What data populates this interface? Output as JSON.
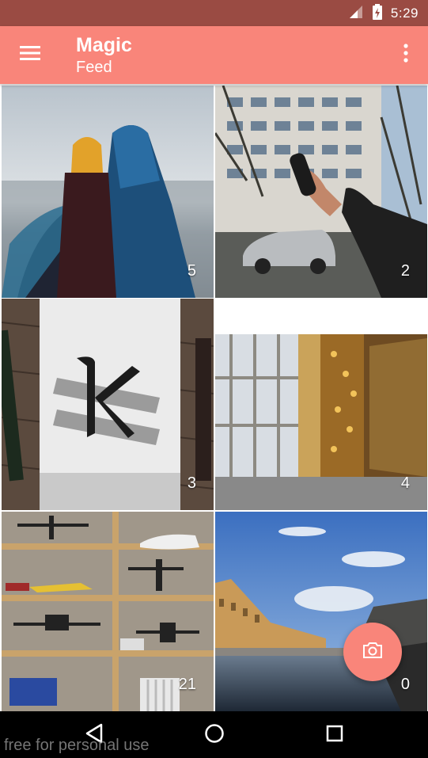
{
  "status_bar": {
    "time": "5:29",
    "icons": [
      "signal-icon",
      "battery-charging-icon"
    ]
  },
  "app_bar": {
    "title": "Magic",
    "subtitle": "Feed",
    "icons": [
      "menu-icon",
      "more-vertical-icon"
    ]
  },
  "colors": {
    "accent": "#f9857a",
    "status_bar": "#9a4b43",
    "nav_bar": "#000000"
  },
  "feed": {
    "tiles": [
      {
        "count": "5"
      },
      {
        "count": "2"
      },
      {
        "count": "3"
      },
      {
        "count": "4"
      },
      {
        "count": "21"
      },
      {
        "count": "0"
      }
    ]
  },
  "fab": {
    "icon": "camera-icon"
  },
  "nav_bar": {
    "icons": [
      "back-icon",
      "home-icon",
      "recents-icon"
    ]
  },
  "watermark": "free for personal use"
}
